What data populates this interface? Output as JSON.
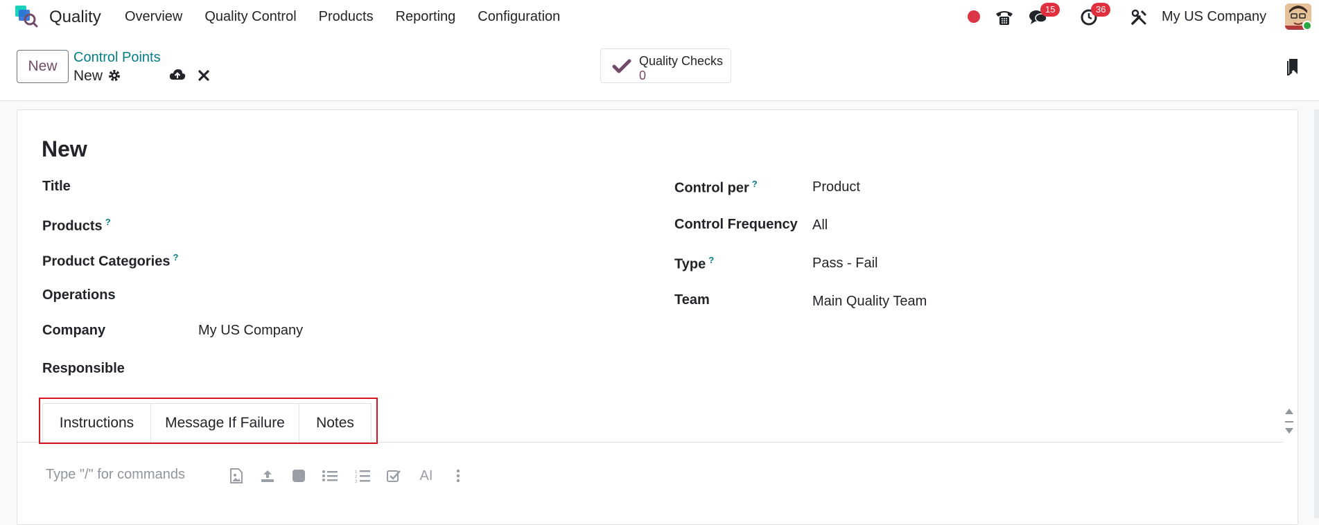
{
  "navbar": {
    "app_name": "Quality",
    "menu": [
      "Overview",
      "Quality Control",
      "Products",
      "Reporting",
      "Configuration"
    ],
    "messages_count": "15",
    "activities_count": "36",
    "company": "My US Company",
    "icons": [
      "recording-dot-icon",
      "phone-icon",
      "chat-icon",
      "clock-icon",
      "tools-icon"
    ]
  },
  "control": {
    "new_button": "New",
    "breadcrumb": "Control Points",
    "record_name": "New",
    "smart_button_label": "Quality Checks",
    "smart_button_value": "0"
  },
  "form": {
    "title": "New",
    "left_fields": [
      {
        "label": "Title",
        "value": "",
        "help": false
      },
      {
        "label": "Products",
        "value": "",
        "help": true
      },
      {
        "label": "Product Categories",
        "value": "",
        "help": true
      },
      {
        "label": "Operations",
        "value": "",
        "help": false
      },
      {
        "label": "Company",
        "value": "My US Company",
        "help": false
      },
      {
        "label": "Responsible",
        "value": "",
        "help": false
      }
    ],
    "right_fields": [
      {
        "label": "Control per",
        "value": "Product",
        "help": true
      },
      {
        "label": "Control Frequency",
        "value": "All",
        "help": false
      },
      {
        "label": "Type",
        "value": "Pass - Fail",
        "help": true
      },
      {
        "label": "Team",
        "value": "Main Quality Team",
        "help": false
      }
    ],
    "help_mark": "?"
  },
  "tabs": [
    "Instructions",
    "Message If Failure",
    "Notes"
  ],
  "editor": {
    "placeholder": "Type \"/\" for commands",
    "ai_label": "AI"
  },
  "colors": {
    "brand": "#714b67",
    "link": "#017e84",
    "highlight": "#d7141f"
  }
}
